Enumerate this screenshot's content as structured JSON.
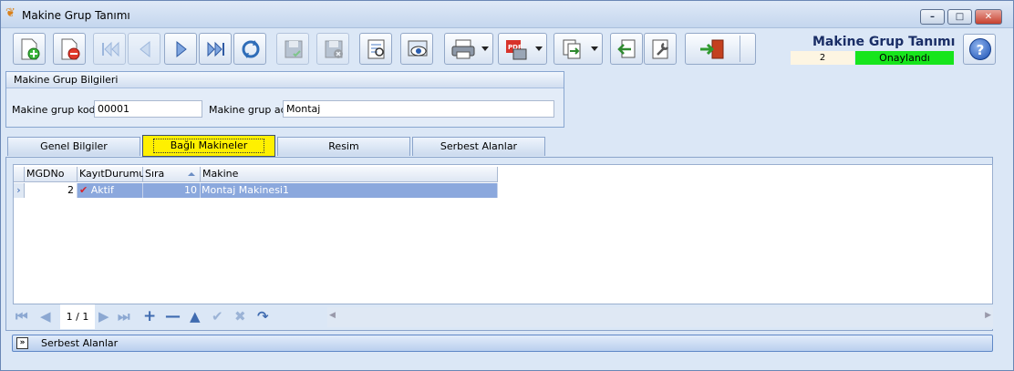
{
  "window": {
    "title": "Makine Grup Tanımı",
    "minimize": "–",
    "maximize": "□",
    "close": "✕"
  },
  "header": {
    "title": "Makine Grup Tanımı",
    "record_count": "2",
    "status": "Onaylandı",
    "status_color": "#17e51c",
    "help": "?"
  },
  "toolbar": {
    "buttons": [
      "new-icon",
      "delete-icon",
      "first-icon",
      "prev-icon",
      "next-icon",
      "last-icon",
      "refresh-icon",
      "save-icon",
      "cancel-save-icon",
      "report-icon",
      "preview-icon",
      "print-icon",
      "pdf-icon",
      "copy-icon",
      "import-icon",
      "settings-icon",
      "exit-icon"
    ]
  },
  "group": {
    "title": "Makine Grup Bilgileri",
    "code_label": "Makine grup kodu",
    "code_value": "00001",
    "name_label": "Makine grup adı",
    "name_value": "Montaj"
  },
  "tabs": [
    "Genel Bilgiler",
    "Bağlı Makineler",
    "Resim",
    "Serbest Alanlar"
  ],
  "grid": {
    "columns": [
      "MGDNo",
      "KayıtDurumu",
      "Sıra",
      "Makine"
    ],
    "rows": [
      {
        "MGDNo": "2",
        "KayitDurumu": "Aktif",
        "Sira": "10",
        "Makine": "Montaj Makinesi1"
      }
    ]
  },
  "navigator": {
    "record": "1 / 1"
  },
  "footer": {
    "serbest_label": "Serbest Alanlar"
  }
}
